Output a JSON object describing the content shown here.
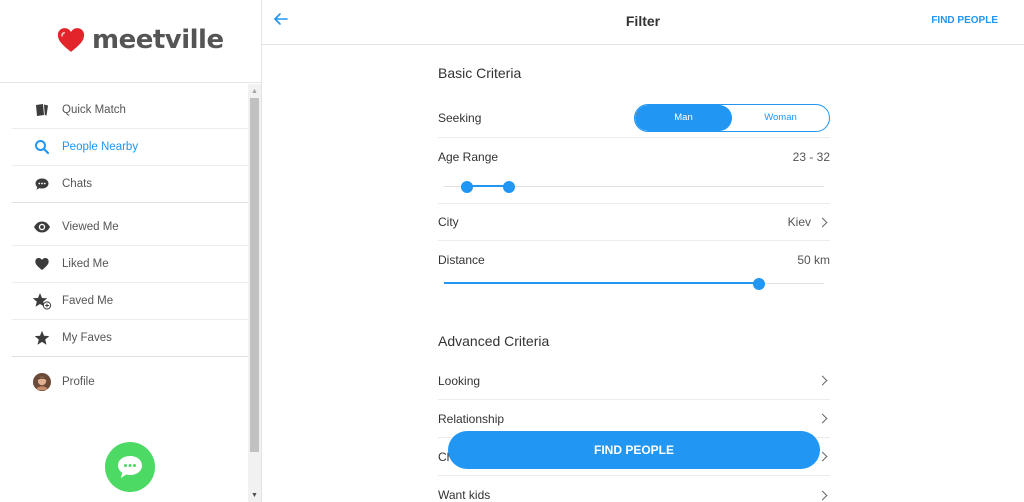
{
  "brand": {
    "name": "meetville",
    "heart_color": "#e3242b",
    "accent": "#2196f3"
  },
  "sidebar": {
    "items": [
      {
        "label": "Quick Match",
        "icon": "cards-icon",
        "active": false
      },
      {
        "label": "People Nearby",
        "icon": "search-icon",
        "active": true
      },
      {
        "label": "Chats",
        "icon": "chat-bubble-icon",
        "active": false
      },
      {
        "label": "Viewed Me",
        "icon": "eye-icon",
        "active": false
      },
      {
        "label": "Liked Me",
        "icon": "heart-icon",
        "active": false
      },
      {
        "label": "Faved Me",
        "icon": "star-plus-icon",
        "active": false
      },
      {
        "label": "My Faves",
        "icon": "star-icon",
        "active": false
      },
      {
        "label": "Profile",
        "icon": "avatar",
        "active": false
      }
    ]
  },
  "header": {
    "title": "Filter",
    "action": "FIND PEOPLE"
  },
  "basic": {
    "title": "Basic Criteria",
    "seeking": {
      "label": "Seeking",
      "options": [
        "Man",
        "Woman"
      ],
      "selected": "Man"
    },
    "age": {
      "label": "Age Range",
      "value": "23 - 32",
      "min_frac": 0.06,
      "max_frac": 0.17
    },
    "city": {
      "label": "City",
      "value": "Kiev"
    },
    "distance": {
      "label": "Distance",
      "value": "50 km",
      "frac": 0.83
    }
  },
  "advanced": {
    "title": "Advanced Criteria",
    "items": [
      "Looking",
      "Relationship",
      "Ch",
      "Want kids"
    ]
  },
  "footer": {
    "button": "FIND PEOPLE"
  }
}
